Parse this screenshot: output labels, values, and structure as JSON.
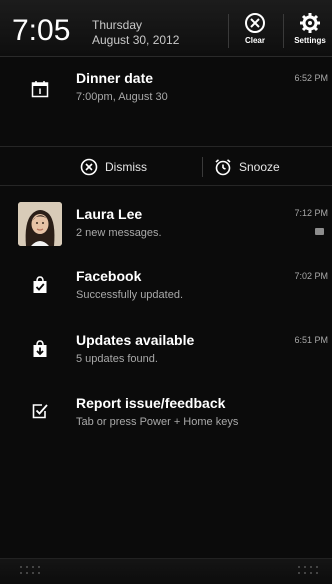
{
  "status": {
    "time": "7:05",
    "day": "Thursday",
    "date": "August 30, 2012",
    "clear_label": "Clear",
    "settings_label": "Settings"
  },
  "notifications": [
    {
      "title": "Dinner date",
      "subtitle": "7:00pm, August 30",
      "time": "6:52 PM",
      "icon": "calendar-icon"
    },
    {
      "title": "Laura Lee",
      "subtitle": "2 new messages.",
      "time": "7:12 PM",
      "icon": "contact-avatar"
    },
    {
      "title": "Facebook",
      "subtitle": "Successfully updated.",
      "time": "7:02 PM",
      "icon": "bag-check-icon"
    },
    {
      "title": "Updates available",
      "subtitle": "5 updates found.",
      "time": "6:51 PM",
      "icon": "bag-download-icon"
    },
    {
      "title": "Report issue/feedback",
      "subtitle": "Tab or press Power + Home keys",
      "time": "",
      "icon": "checkbox-icon"
    }
  ],
  "actions": {
    "dismiss_label": "Dismiss",
    "snooze_label": "Snooze"
  },
  "colors": {
    "background": "#0b0b0b",
    "text_primary": "#ffffff",
    "text_secondary": "#a9a9a9"
  }
}
